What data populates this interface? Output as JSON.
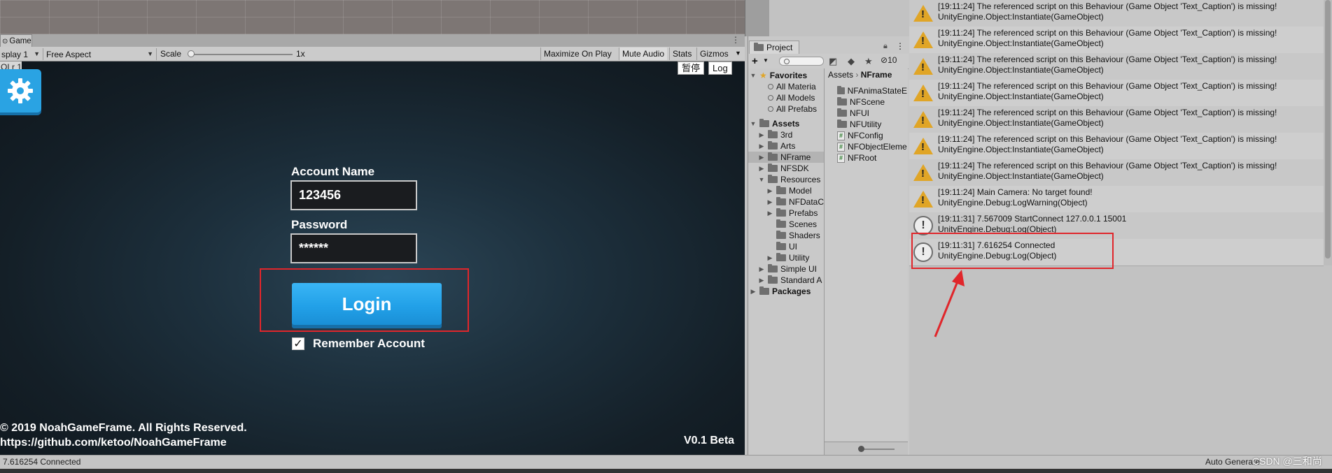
{
  "game_window": {
    "tab_label": "Game",
    "display_dropdown": "splay 1",
    "aspect_dropdown": "Free Aspect",
    "scale_label": "Scale",
    "scale_value": "1x",
    "buttons": [
      "Maximize On Play",
      "Mute Audio",
      "Stats",
      "Gizmos"
    ],
    "overlay_buttons": [
      "暂停",
      "Log"
    ],
    "corner_tag": "OLr 1",
    "login": {
      "account_label": "Account Name",
      "account_value": "123456",
      "password_label": "Password",
      "password_value": "******",
      "login_button": "Login",
      "remember_label": "Remember Account",
      "remember_checked": true
    },
    "copyright_line1": "© 2019 NoahGameFrame. All Rights Reserved.",
    "copyright_line2": "https://github.com/ketoo/NoahGameFrame",
    "version": "V0.1 Beta"
  },
  "project_window": {
    "tab_label": "Project",
    "hidden_count": "10",
    "tree": [
      {
        "label": "Favorites",
        "level": 0,
        "arrow": "▼",
        "icon": "star-icon",
        "bold": true
      },
      {
        "label": "All Materia",
        "level": 1,
        "arrow": "",
        "icon": "search-icon",
        "bold": false
      },
      {
        "label": "All Models",
        "level": 1,
        "arrow": "",
        "icon": "search-icon",
        "bold": false
      },
      {
        "label": "All Prefabs",
        "level": 1,
        "arrow": "",
        "icon": "search-icon",
        "bold": false
      },
      {
        "label": "Assets",
        "level": 0,
        "arrow": "▼",
        "icon": "folder-icon",
        "bold": true
      },
      {
        "label": "3rd",
        "level": 1,
        "arrow": "▶",
        "icon": "folder-icon",
        "bold": false
      },
      {
        "label": "Arts",
        "level": 1,
        "arrow": "▶",
        "icon": "folder-icon",
        "bold": false
      },
      {
        "label": "NFrame",
        "level": 1,
        "arrow": "▶",
        "icon": "folder-icon",
        "bold": false,
        "selected": true
      },
      {
        "label": "NFSDK",
        "level": 1,
        "arrow": "▶",
        "icon": "folder-icon",
        "bold": false
      },
      {
        "label": "Resources",
        "level": 1,
        "arrow": "▼",
        "icon": "folder-icon",
        "bold": false
      },
      {
        "label": "Model",
        "level": 2,
        "arrow": "▶",
        "icon": "folder-icon",
        "bold": false
      },
      {
        "label": "NFDataC",
        "level": 2,
        "arrow": "▶",
        "icon": "folder-icon",
        "bold": false
      },
      {
        "label": "Prefabs",
        "level": 2,
        "arrow": "▶",
        "icon": "folder-icon",
        "bold": false
      },
      {
        "label": "Scenes",
        "level": 2,
        "arrow": "",
        "icon": "folder-icon",
        "bold": false
      },
      {
        "label": "Shaders",
        "level": 2,
        "arrow": "",
        "icon": "folder-icon",
        "bold": false
      },
      {
        "label": "UI",
        "level": 2,
        "arrow": "",
        "icon": "folder-icon",
        "bold": false
      },
      {
        "label": "Utility",
        "level": 2,
        "arrow": "▶",
        "icon": "folder-icon",
        "bold": false
      },
      {
        "label": "Simple UI",
        "level": 1,
        "arrow": "▶",
        "icon": "folder-icon",
        "bold": false
      },
      {
        "label": "Standard A",
        "level": 1,
        "arrow": "▶",
        "icon": "folder-icon",
        "bold": false
      },
      {
        "label": "Packages",
        "level": 0,
        "arrow": "▶",
        "icon": "folder-icon",
        "bold": true
      }
    ],
    "breadcrumb": [
      "Assets",
      "NFrame"
    ],
    "files": [
      {
        "label": "NFAnimaStateE",
        "icon": "folder-icon"
      },
      {
        "label": "NFScene",
        "icon": "folder-icon"
      },
      {
        "label": "NFUI",
        "icon": "folder-icon"
      },
      {
        "label": "NFUtility",
        "icon": "folder-icon"
      },
      {
        "label": "NFConfig",
        "icon": "script-icon"
      },
      {
        "label": "NFObjectEleme",
        "icon": "script-icon"
      },
      {
        "label": "NFRoot",
        "icon": "script-icon"
      }
    ]
  },
  "console": {
    "entries": [
      {
        "type": "warning",
        "line1": "[19:11:24] The referenced script on this Behaviour (Game Object 'Text_Caption') is missing!",
        "line2": "UnityEngine.Object:Instantiate(GameObject)"
      },
      {
        "type": "warning",
        "line1": "[19:11:24] The referenced script on this Behaviour (Game Object 'Text_Caption') is missing!",
        "line2": "UnityEngine.Object:Instantiate(GameObject)"
      },
      {
        "type": "warning",
        "line1": "[19:11:24] The referenced script on this Behaviour (Game Object 'Text_Caption') is missing!",
        "line2": "UnityEngine.Object:Instantiate(GameObject)"
      },
      {
        "type": "warning",
        "line1": "[19:11:24] The referenced script on this Behaviour (Game Object 'Text_Caption') is missing!",
        "line2": "UnityEngine.Object:Instantiate(GameObject)"
      },
      {
        "type": "warning",
        "line1": "[19:11:24] The referenced script on this Behaviour (Game Object 'Text_Caption') is missing!",
        "line2": "UnityEngine.Object:Instantiate(GameObject)"
      },
      {
        "type": "warning",
        "line1": "[19:11:24] The referenced script on this Behaviour (Game Object 'Text_Caption') is missing!",
        "line2": "UnityEngine.Object:Instantiate(GameObject)"
      },
      {
        "type": "warning",
        "line1": "[19:11:24] The referenced script on this Behaviour (Game Object 'Text_Caption') is missing!",
        "line2": "UnityEngine.Object:Instantiate(GameObject)"
      },
      {
        "type": "warning",
        "line1": "[19:11:24] Main Camera: No target found!",
        "line2": "UnityEngine.Debug:LogWarning(Object)"
      },
      {
        "type": "info",
        "line1": "[19:11:31] 7.567009 StartConnect 127.0.0.1 15001",
        "line2": "UnityEngine.Debug:Log(Object)"
      },
      {
        "type": "info",
        "line1": "[19:11:31] 7.616254 Connected",
        "line2": "UnityEngine.Debug:Log(Object)"
      }
    ]
  },
  "status_bar": {
    "message": "7.616254 Connected",
    "right_text": "Auto Generate",
    "watermark": "CSDN @三和尚"
  },
  "colors": {
    "highlight_red": "#e0262b",
    "login_blue": "#22a1e8",
    "warning_yellow": "#e0a526"
  }
}
